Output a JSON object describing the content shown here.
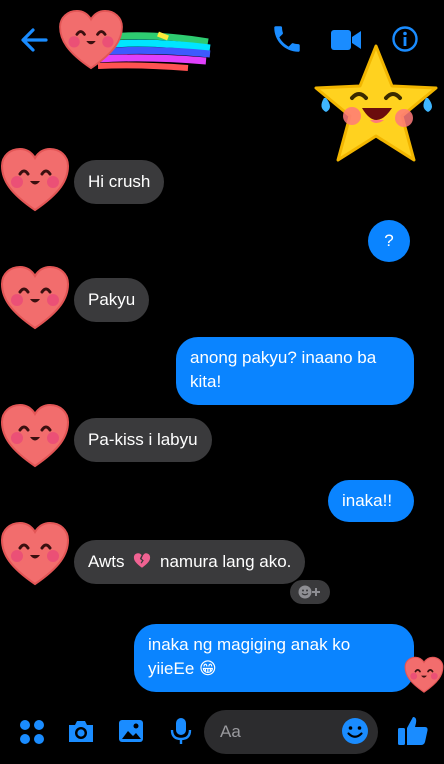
{
  "header": {
    "back_icon": "arrow-left-icon",
    "call_icon": "phone-icon",
    "video_icon": "video-camera-icon",
    "info_icon": "info-icon"
  },
  "messages": [
    {
      "direction": "in",
      "text": "Hi crush"
    },
    {
      "direction": "out",
      "text": "?"
    },
    {
      "direction": "in",
      "text": "Pakyu"
    },
    {
      "direction": "out",
      "text": "anong pakyu? inaano ba kita!"
    },
    {
      "direction": "in",
      "text": "Pa-kiss i labyu"
    },
    {
      "direction": "out",
      "text": "inaka!!"
    },
    {
      "direction": "in",
      "text_before": "Awts",
      "emoji": "broken-heart",
      "text_after": "namura lang ako."
    },
    {
      "direction": "out",
      "text": "inaka ng magiging anak ko yiieEe 😁"
    }
  ],
  "composer": {
    "placeholder": "Aa",
    "icons": [
      "apps-icon",
      "camera-icon",
      "image-icon",
      "microphone-icon",
      "emoji-icon",
      "thumbs-up-icon"
    ]
  },
  "colors": {
    "background": "#000000",
    "accent": "#0a84ff",
    "incoming_bubble": "#3a3a3c"
  }
}
